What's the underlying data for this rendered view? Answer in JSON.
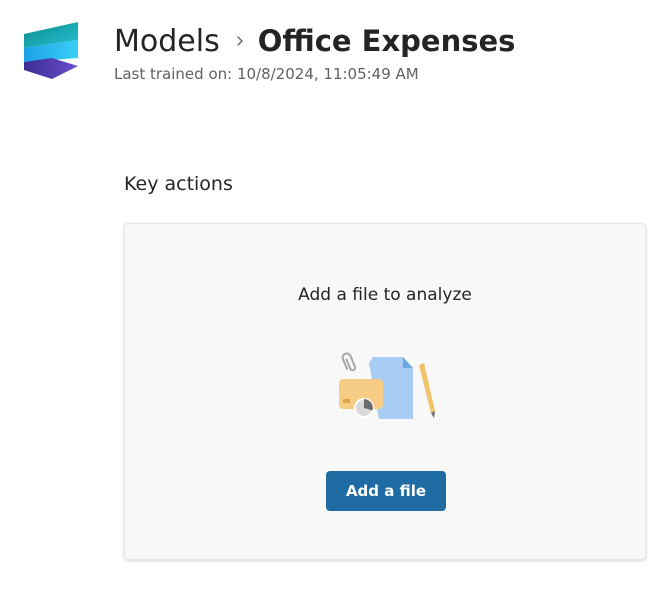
{
  "header": {
    "logo_icon": "app-logo-icon",
    "breadcrumb": {
      "parent": "Models",
      "separator_icon": "chevron-right-icon",
      "current": "Office Expenses"
    },
    "last_trained": "Last trained on: 10/8/2024, 11:05:49 AM"
  },
  "key_actions": {
    "title": "Key actions",
    "card": {
      "title": "Add a file to analyze",
      "illustration_icon": "file-attachment-illustration",
      "button_label": "Add a file"
    }
  },
  "colors": {
    "accent": "#1f6ba3",
    "card_background": "#f8f8f8",
    "text_primary": "#242424",
    "text_secondary": "#616161"
  }
}
